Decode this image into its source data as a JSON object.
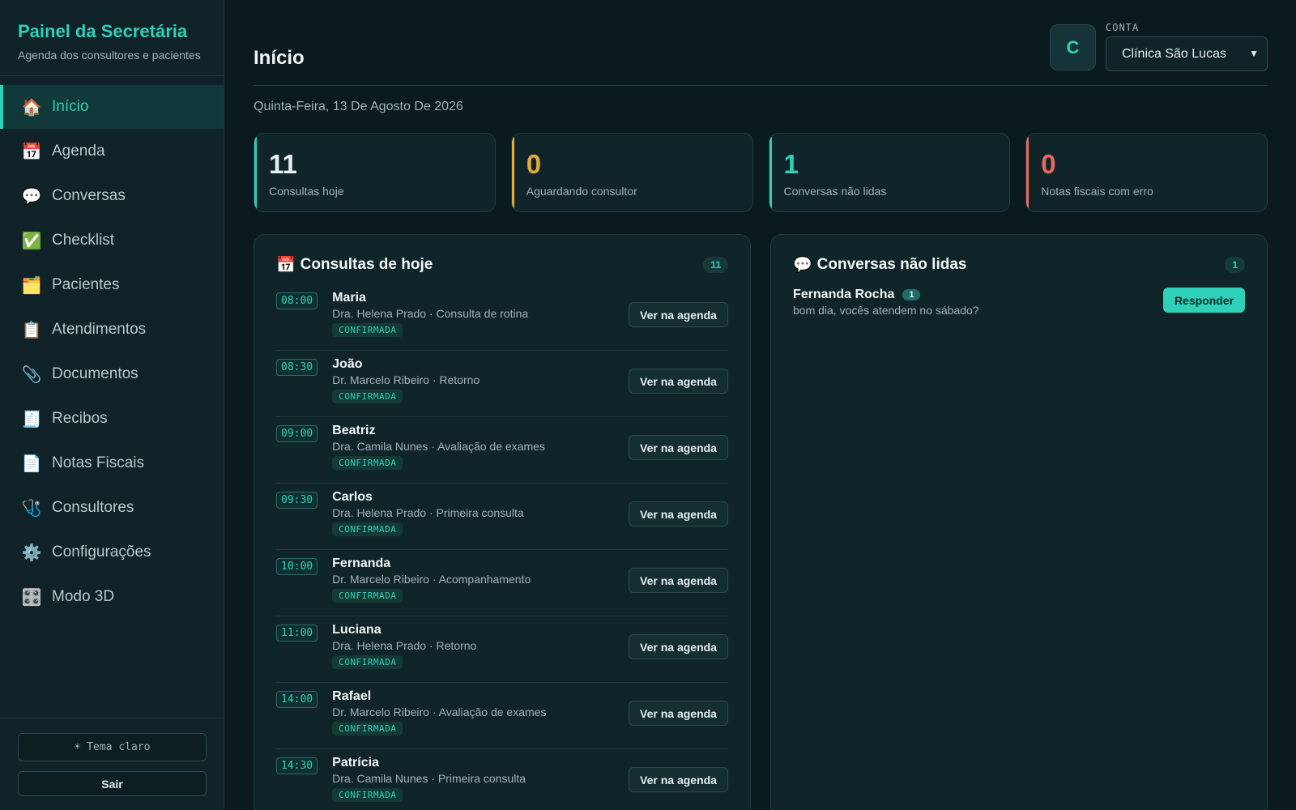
{
  "sidebar": {
    "title": "Painel da Secretária",
    "subtitle": "Agenda dos consultores e pacientes",
    "items": [
      {
        "icon": "🏠",
        "label": "Início"
      },
      {
        "icon": "📅",
        "label": "Agenda"
      },
      {
        "icon": "💬",
        "label": "Conversas"
      },
      {
        "icon": "✅",
        "label": "Checklist"
      },
      {
        "icon": "🗂️",
        "label": "Pacientes"
      },
      {
        "icon": "📋",
        "label": "Atendimentos"
      },
      {
        "icon": "📎",
        "label": "Documentos"
      },
      {
        "icon": "🧾",
        "label": "Recibos"
      },
      {
        "icon": "📄",
        "label": "Notas Fiscais"
      },
      {
        "icon": "🩺",
        "label": "Consultores"
      },
      {
        "icon": "⚙️",
        "label": "Configurações"
      },
      {
        "icon": "🎛️",
        "label": "Modo 3D"
      }
    ],
    "theme_label": "☀ Tema claro",
    "logout_label": "Sair"
  },
  "header": {
    "title": "Início",
    "avatar_letter": "C",
    "account_label": "CONTA",
    "account_value": "Clínica São Lucas"
  },
  "date": "Quinta-Feira, 13 De Agosto De 2026",
  "stats": [
    {
      "value": "11",
      "label": "Consultas hoje",
      "color": "#e6eef0",
      "accent": "#2fd0b8"
    },
    {
      "value": "0",
      "label": "Aguardando consultor",
      "color": "#e8a93a",
      "accent": "#e8a93a"
    },
    {
      "value": "1",
      "label": "Conversas não lidas",
      "color": "#2fd0b8",
      "accent": "#2fd0b8"
    },
    {
      "value": "0",
      "label": "Notas fiscais com erro",
      "color": "#e86a5e",
      "accent": "#e86a5e"
    }
  ],
  "appointments": {
    "icon": "📅",
    "title": "Consultas de hoje",
    "count": "11",
    "button_label": "Ver na agenda",
    "items": [
      {
        "time": "08:00",
        "name": "Maria",
        "detail": "Dra. Helena Prado · Consulta de rotina",
        "status": "CONFIRMADA"
      },
      {
        "time": "08:30",
        "name": "João",
        "detail": "Dr. Marcelo Ribeiro · Retorno",
        "status": "CONFIRMADA"
      },
      {
        "time": "09:00",
        "name": "Beatriz",
        "detail": "Dra. Camila Nunes · Avaliação de exames",
        "status": "CONFIRMADA"
      },
      {
        "time": "09:30",
        "name": "Carlos",
        "detail": "Dra. Helena Prado · Primeira consulta",
        "status": "CONFIRMADA"
      },
      {
        "time": "10:00",
        "name": "Fernanda",
        "detail": "Dr. Marcelo Ribeiro · Acompanhamento",
        "status": "CONFIRMADA"
      },
      {
        "time": "11:00",
        "name": "Luciana",
        "detail": "Dra. Helena Prado · Retorno",
        "status": "CONFIRMADA"
      },
      {
        "time": "14:00",
        "name": "Rafael",
        "detail": "Dr. Marcelo Ribeiro · Avaliação de exames",
        "status": "CONFIRMADA"
      },
      {
        "time": "14:30",
        "name": "Patrícia",
        "detail": "Dra. Camila Nunes · Primeira consulta",
        "status": "CONFIRMADA"
      }
    ]
  },
  "conversations": {
    "icon": "💬",
    "title": "Conversas não lidas",
    "count": "1",
    "button_label": "Responder",
    "items": [
      {
        "name": "Fernanda Rocha",
        "unread": "1",
        "message": "bom dia, vocês atendem no sábado?"
      }
    ]
  }
}
